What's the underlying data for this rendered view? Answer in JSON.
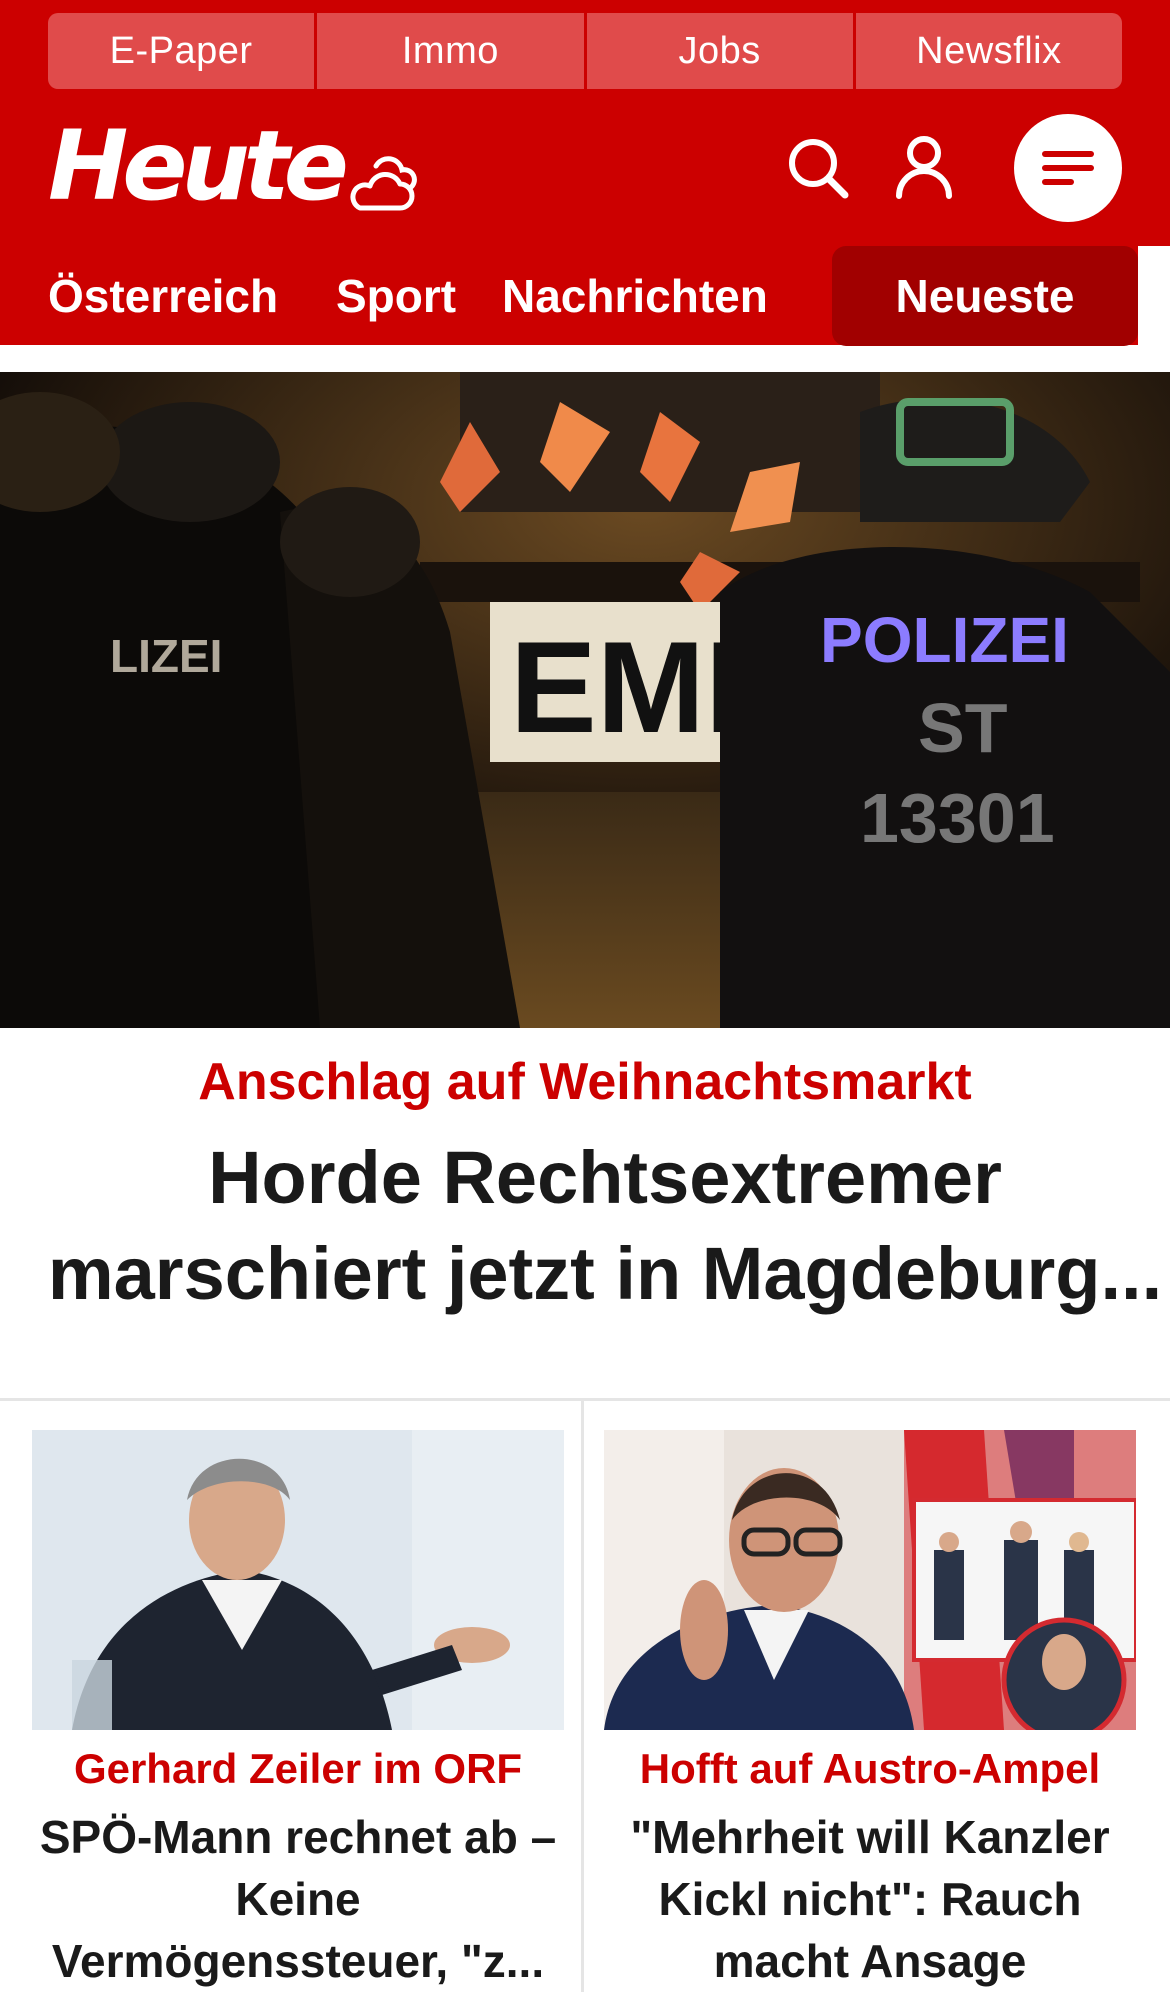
{
  "top_links": [
    "E-Paper",
    "Immo",
    "Jobs",
    "Newsflix"
  ],
  "brand": {
    "logo_text": "Heute"
  },
  "header_icons": {
    "weather": "cloud-icon",
    "search": "search-icon",
    "account": "user-icon",
    "menu": "menu-icon"
  },
  "nav": {
    "items": [
      "Österreich",
      "Sport",
      "Nachrichten"
    ],
    "active": "Neueste"
  },
  "hero": {
    "kicker": "Anschlag auf Weihnachtsmarkt",
    "title_line1": "Horde Rechtsextremer",
    "title_line2": "marschiert jetzt in Magdeburg...",
    "image_texts": {
      "banner": "EMIG",
      "vest_left": "LIZEI",
      "vest_right": "POLIZEI",
      "unit": "ST",
      "number": "13301"
    }
  },
  "cards": [
    {
      "kicker": "Gerhard Zeiler im ORF",
      "title_lines": [
        "SPÖ-Mann rechnet ab –",
        "Keine",
        "Vermögenssteuer, \"z..."
      ]
    },
    {
      "kicker": "Hofft auf Austro-Ampel",
      "title_lines": [
        "\"Mehrheit will Kanzler",
        "Kickl nicht\": Rauch",
        "macht Ansage"
      ]
    }
  ],
  "colors": {
    "brand_red": "#cc0000",
    "nav_active": "#a10000",
    "top_link_bg": "#e04b4b",
    "text_dark": "#1a1a1a"
  }
}
